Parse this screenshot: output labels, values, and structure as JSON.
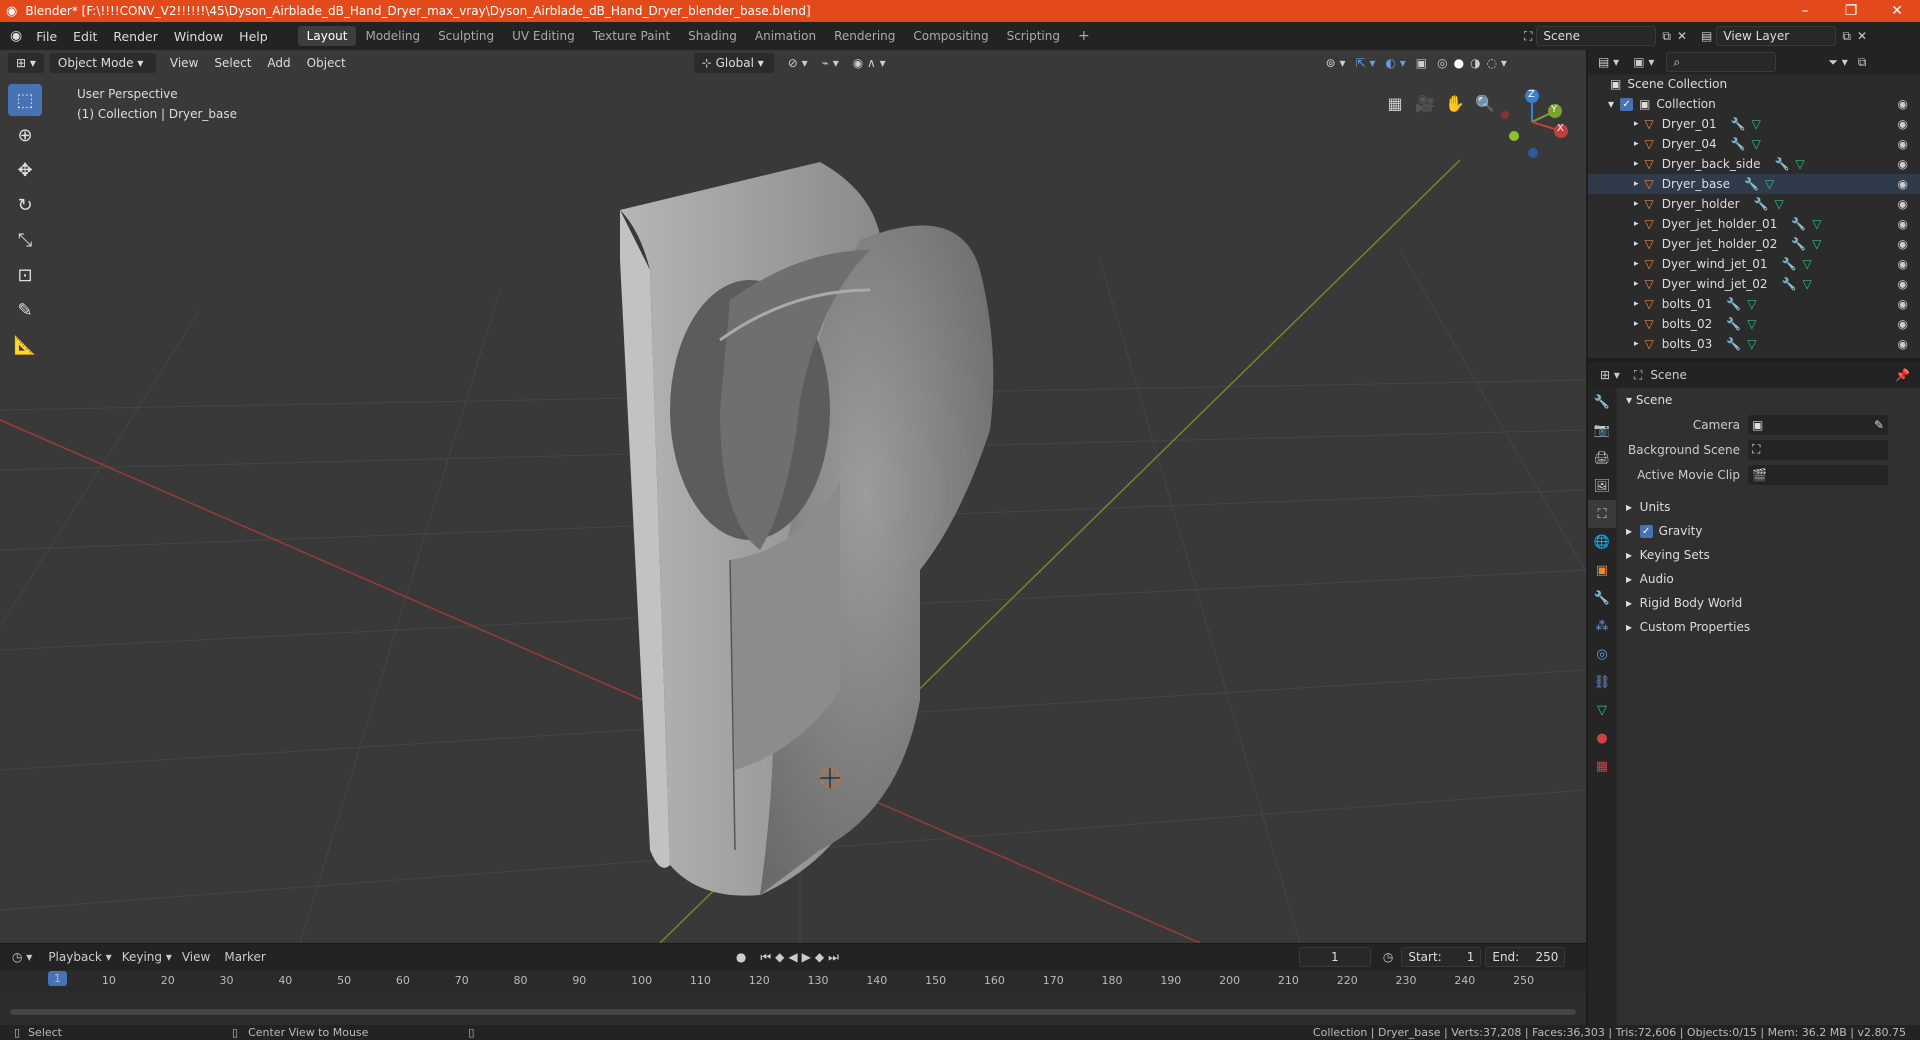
{
  "titlebar": {
    "title": "Blender* [F:\\!!!!CONV_V2!!!!!!\\45\\Dyson_Airblade_dB_Hand_Dryer_max_vray\\Dyson_Airblade_dB_Hand_Dryer_blender_base.blend]"
  },
  "menu": [
    "File",
    "Edit",
    "Render",
    "Window",
    "Help"
  ],
  "workspaces": [
    "Layout",
    "Modeling",
    "Sculpting",
    "UV Editing",
    "Texture Paint",
    "Shading",
    "Animation",
    "Rendering",
    "Compositing",
    "Scripting"
  ],
  "active_workspace": "Layout",
  "scene_name": "Scene",
  "view_layer": "View Layer",
  "viewport": {
    "mode": "Object Mode",
    "menus": [
      "View",
      "Select",
      "Add",
      "Object"
    ],
    "transform_orientation": "Global",
    "perspective_label": "User Perspective",
    "active_object_label": "(1) Collection | Dryer_base",
    "gizmo_axes": {
      "z": "Z",
      "y": "Y",
      "x": "X"
    }
  },
  "outliner": {
    "root": "Scene Collection",
    "collection": "Collection",
    "items": [
      "Dryer_01",
      "Dryer_04",
      "Dryer_back_side",
      "Dryer_base",
      "Dryer_holder",
      "Dyer_jet_holder_01",
      "Dyer_jet_holder_02",
      "Dyer_wind_jet_01",
      "Dyer_wind_jet_02",
      "bolts_01",
      "bolts_02",
      "bolts_03"
    ],
    "selected": "Dryer_base"
  },
  "properties": {
    "header": "Scene",
    "section": "Scene",
    "camera_label": "Camera",
    "background_scene_label": "Background Scene",
    "active_movie_clip_label": "Active Movie Clip",
    "subsections": [
      "Units",
      "Gravity",
      "Keying Sets",
      "Audio",
      "Rigid Body World",
      "Custom Properties"
    ],
    "gravity_checked": true
  },
  "timeline": {
    "menus": [
      "Playback",
      "Keying",
      "View",
      "Marker"
    ],
    "current_frame": "1",
    "start_label": "Start:",
    "start": "1",
    "end_label": "End:",
    "end": "250",
    "ticks": [
      "1",
      "10",
      "20",
      "30",
      "40",
      "50",
      "60",
      "70",
      "80",
      "90",
      "100",
      "110",
      "120",
      "130",
      "140",
      "150",
      "160",
      "170",
      "180",
      "190",
      "200",
      "210",
      "220",
      "230",
      "240",
      "250"
    ]
  },
  "statusbar": {
    "left": "Select",
    "middle": "Center View to Mouse",
    "right": "Collection | Dryer_base | Verts:37,208 | Faces:36,303 | Tris:72,606 | Objects:0/15 | Mem: 36.2 MB | v2.80.75"
  },
  "colors": {
    "accent": "#4772b3",
    "title_bg": "#e24a1b",
    "x_axis": "#c0403f",
    "y_axis": "#7ca22a",
    "object_orange": "#e8883a"
  }
}
